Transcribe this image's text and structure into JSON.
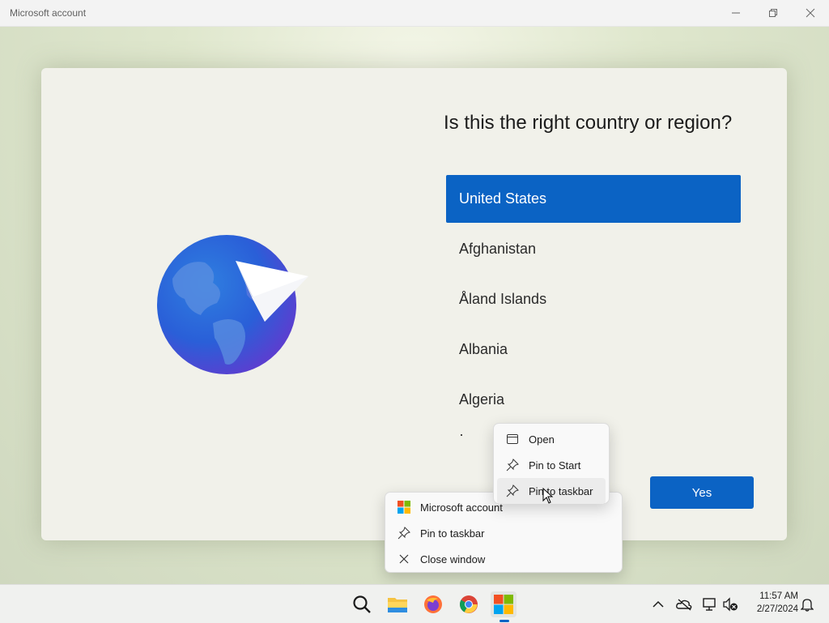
{
  "window": {
    "title": "Microsoft account",
    "controls": [
      "minimize",
      "restore",
      "close"
    ]
  },
  "setup": {
    "question": "Is this the right country or region?",
    "countries": [
      "United States",
      "Afghanistan",
      "Åland Islands",
      "Albania",
      "Algeria",
      "·"
    ],
    "selected_country": "United States",
    "yes_label": "Yes"
  },
  "app_jump_menu": {
    "items": [
      {
        "label": "Open",
        "icon": "window-icon"
      },
      {
        "label": "Pin to Start",
        "icon": "pin-icon"
      },
      {
        "label": "Pin to taskbar",
        "icon": "pin-icon"
      }
    ],
    "hovered_item": "Pin to taskbar"
  },
  "taskbar_jump_menu": {
    "items": [
      {
        "label": "Microsoft account",
        "icon": "microsoft-logo-icon"
      },
      {
        "label": "Pin to taskbar",
        "icon": "pin-icon"
      },
      {
        "label": "Close window",
        "icon": "close-icon"
      }
    ]
  },
  "taskbar": {
    "apps": [
      "search-icon",
      "file-explorer-icon",
      "firefox-icon",
      "chrome-icon",
      "microsoft-account-icon"
    ],
    "active_app": "Microsoft account",
    "tray_icons": [
      "chevron-up-icon",
      "onedrive-icon",
      "network-icon",
      "volume-muted-icon"
    ],
    "time": "11:57 AM",
    "date": "2/27/2024",
    "notification_icon": "bell-icon"
  },
  "colors": {
    "accent": "#0b63c4",
    "card_background": "#f1f1ea"
  }
}
